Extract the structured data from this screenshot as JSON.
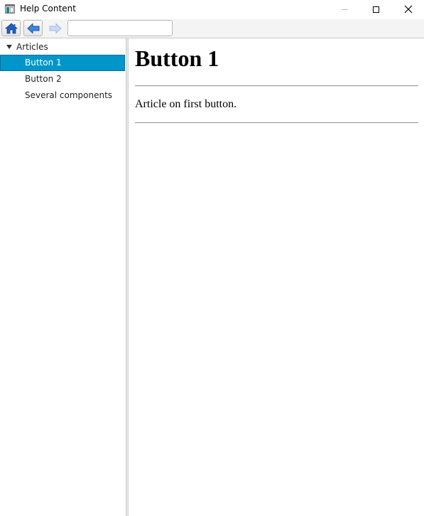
{
  "window": {
    "title": "Help Content"
  },
  "toolbar": {
    "address_value": ""
  },
  "tree": {
    "root_label": "Articles",
    "items": [
      {
        "label": "Button 1",
        "selected": true
      },
      {
        "label": "Button 2",
        "selected": false
      },
      {
        "label": "Several components",
        "selected": false
      }
    ]
  },
  "content": {
    "heading": "Button 1",
    "body": "Article on first button."
  },
  "colors": {
    "selection": "#0096c9",
    "icon_blue": "#1f5fbf",
    "icon_disabled": "#9fbbe6"
  }
}
